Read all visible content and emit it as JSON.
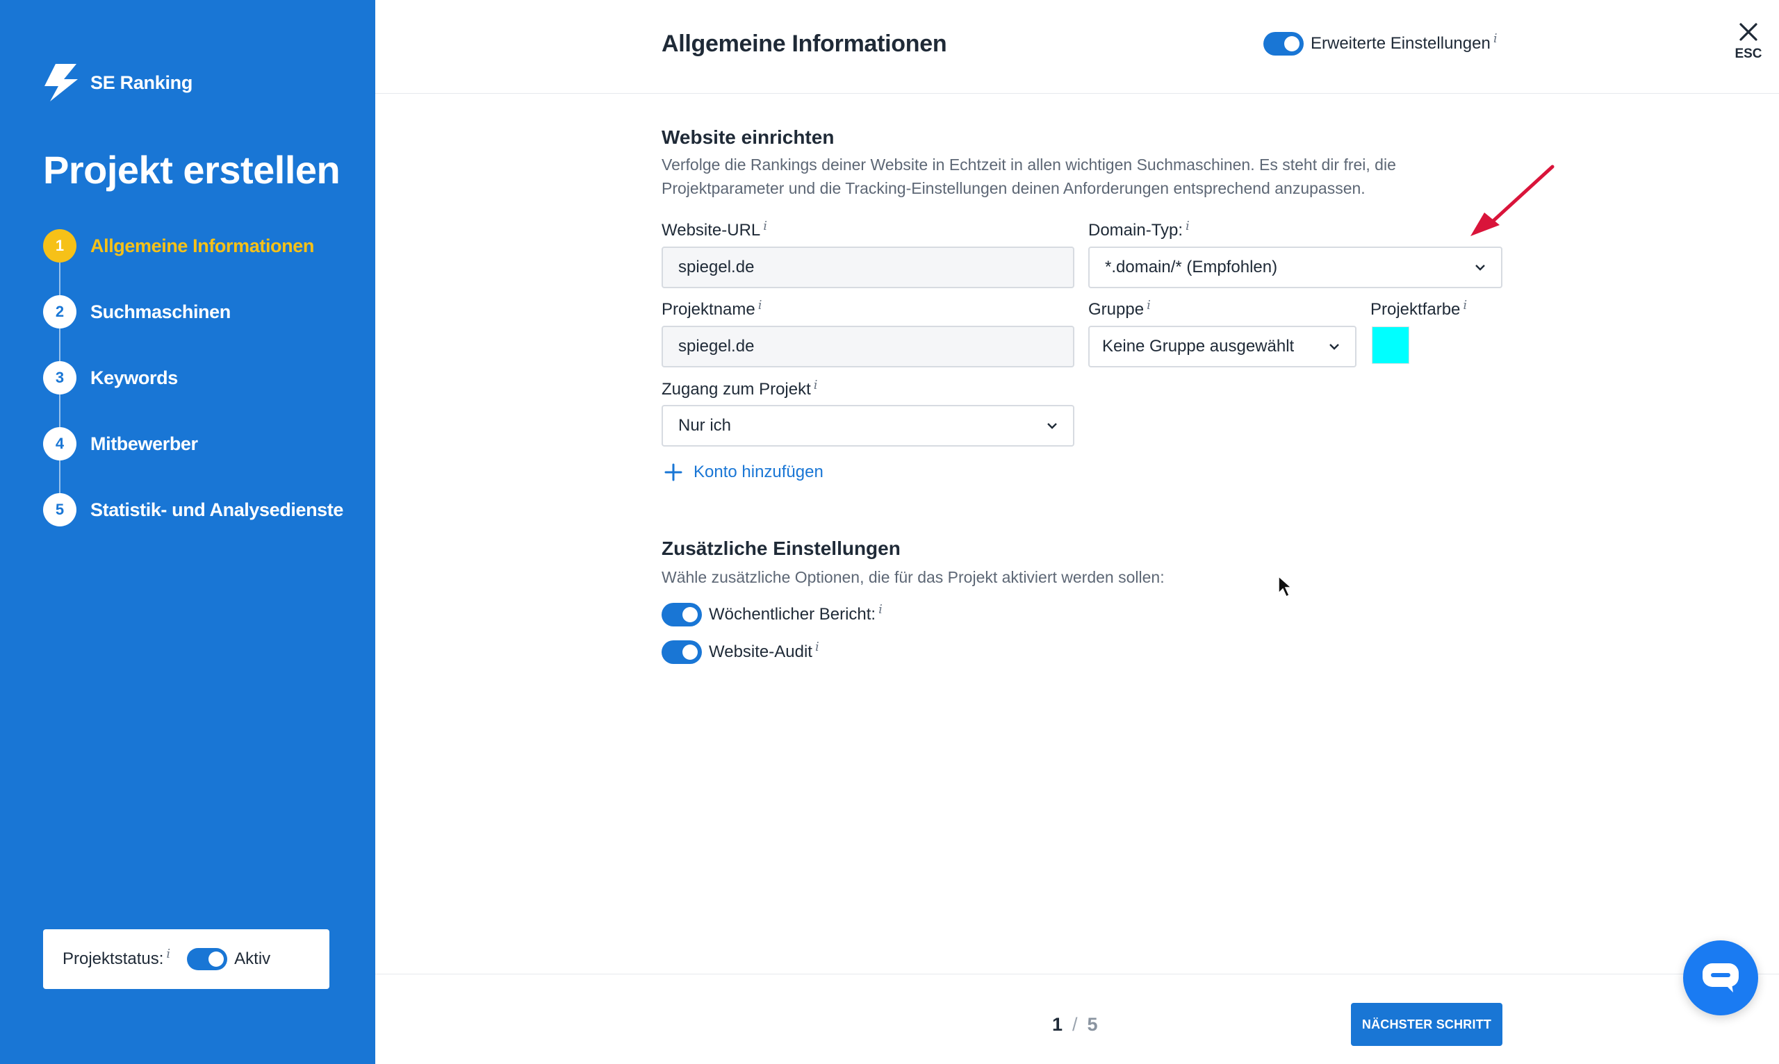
{
  "brand": {
    "name": "SE Ranking"
  },
  "sidebar": {
    "title": "Projekt erstellen",
    "steps": [
      {
        "num": "1",
        "label": "Allgemeine Informationen",
        "active": true
      },
      {
        "num": "2",
        "label": "Suchmaschinen"
      },
      {
        "num": "3",
        "label": "Keywords"
      },
      {
        "num": "4",
        "label": "Mitbewerber"
      },
      {
        "num": "5",
        "label": "Statistik- und Analysedienste"
      }
    ],
    "status": {
      "label": "Projektstatus:",
      "value": "Aktiv",
      "enabled": true
    }
  },
  "header": {
    "title": "Allgemeine Informationen",
    "advanced_label": "Erweiterte Einstellungen",
    "advanced_enabled": true,
    "close_label": "ESC"
  },
  "website": {
    "title": "Website einrichten",
    "desc_line1": "Verfolge die Rankings deiner Website in Echtzeit in allen wichtigen Suchmaschinen. Es steht dir frei, die",
    "desc_line2": "Projektparameter und die Tracking-Einstellungen deinen Anforderungen entsprechend anzupassen.",
    "url_label": "Website-URL",
    "url_value": "spiegel.de",
    "domain_label": "Domain-Typ:",
    "domain_value": "*.domain/* (Empfohlen)",
    "name_label": "Projektname",
    "name_value": "spiegel.de",
    "group_label": "Gruppe",
    "group_value": "Keine Gruppe ausgewählt",
    "color_label": "Projektfarbe",
    "color_value": "#00ffff",
    "access_label": "Zugang zum Projekt",
    "access_value": "Nur ich",
    "add_account": "Konto hinzufügen",
    "info": "i"
  },
  "extra": {
    "title": "Zusätzliche Einstellungen",
    "desc": "Wähle zusätzliche Optionen, die für das Projekt aktiviert werden sollen:",
    "options": [
      {
        "label": "Wöchentlicher Bericht:",
        "enabled": true
      },
      {
        "label": "Website-Audit",
        "enabled": true
      }
    ]
  },
  "footer": {
    "page_current": "1",
    "page_sep": "/",
    "page_total": "5",
    "next_label": "NÄCHSTER SCHRITT"
  },
  "colors": {
    "primary": "#1976d5",
    "active_step": "#f6c118",
    "annotation_arrow": "#d9143a",
    "chat": "#1a7bf2"
  }
}
